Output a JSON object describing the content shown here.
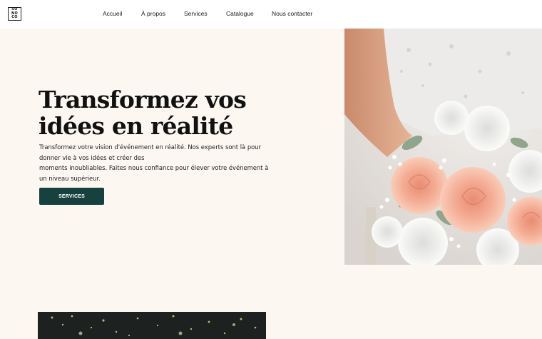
{
  "nav": {
    "logo_lines": [
      "SO",
      "NO",
      "CO"
    ],
    "links": [
      "Accueil",
      "À propos",
      "Services",
      "Catalogue",
      "Nous contacter"
    ]
  },
  "hero": {
    "title_line1": "Transformez vos",
    "title_line2": "idées en réalité",
    "text_lines": [
      "Transformez votre vision d'événement en réalité. Nos experts sont là pour",
      "donner vie à vos idées et créer des",
      "moments inoubliables. Faites nous confiance pour élever votre événement à",
      "un niveau supérieur."
    ],
    "button_label": "SERVICES"
  },
  "colors": {
    "background": "#fdf7f1",
    "button": "#17413e",
    "nav_bg": "#ffffff"
  },
  "images": {
    "hero_photo": "bridal-bouquet-photo",
    "bottom_photo": "fireworks-photo"
  }
}
